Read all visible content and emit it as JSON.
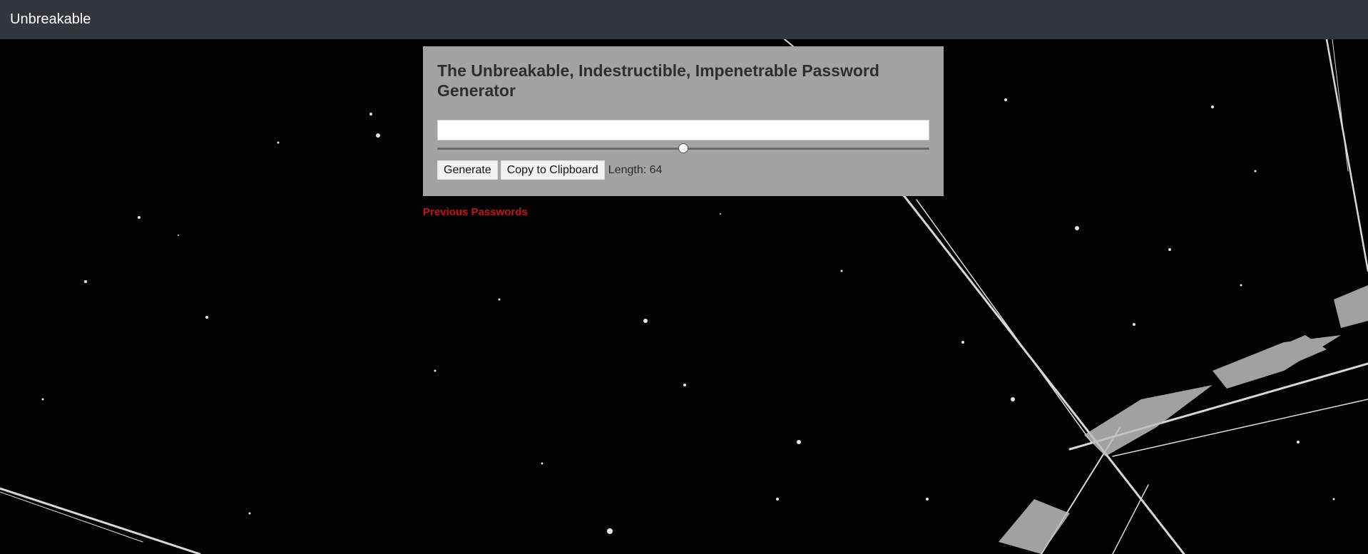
{
  "navbar": {
    "brand": "Unbreakable"
  },
  "generator": {
    "title": "The Unbreakable, Indestructible, Impenetrable Password Generator",
    "password_value": "",
    "length_slider": {
      "value": 64,
      "fraction": 0.5
    },
    "generate_label": "Generate",
    "copy_label": "Copy to Clipboard",
    "length_label": "Length: 64"
  },
  "links": {
    "previous_passwords": "Previous Passwords"
  },
  "colors": {
    "navbar_bg": "#31353c",
    "card_bg": "#a3a3a3",
    "link": "#c41414",
    "background": "#020202"
  },
  "background_image": "shattered-glass"
}
